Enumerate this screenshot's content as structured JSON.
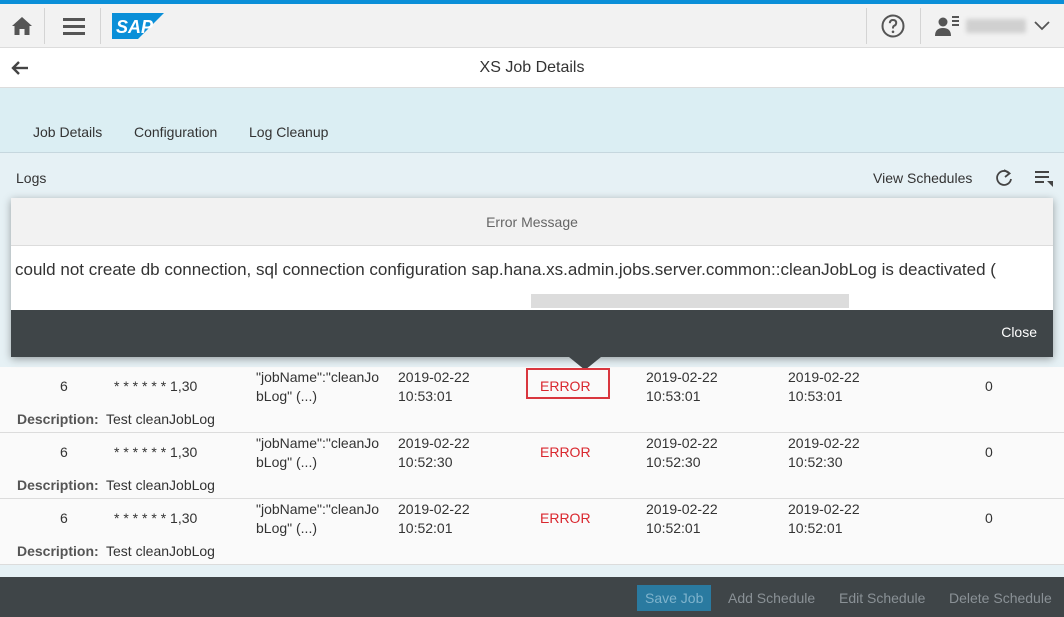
{
  "shell": {
    "logo_text": "SAP",
    "icons": {
      "home": "home-icon",
      "menu": "menu-icon",
      "help": "help-icon",
      "user": "user-icon",
      "chevron": "chevron-down-icon"
    }
  },
  "page": {
    "title": "XS Job Details"
  },
  "tabs": [
    {
      "label": "Job Details"
    },
    {
      "label": "Configuration"
    },
    {
      "label": "Log Cleanup"
    }
  ],
  "logs_toolbar": {
    "title": "Logs",
    "view_schedules": "View Schedules"
  },
  "error_popover": {
    "title": "Error Message",
    "message": "could not create db connection, sql connection configuration sap.hana.xs.admin.jobs.server.common::cleanJobLog is deactivated (",
    "close_label": "Close"
  },
  "log_rows": [
    {
      "num": "6",
      "schedule": "* * * * * * 1,30",
      "params_line1": "\"jobName\":\"cleanJo",
      "params_line2": "bLog\" (...)",
      "planned_date": "2019-02-22",
      "planned_time": "10:53:01",
      "status": "ERROR",
      "started_date": "2019-02-22",
      "started_time": "10:53:01",
      "finished_date": "2019-02-22",
      "finished_time": "10:53:01",
      "count": "0",
      "description_label": "Description:",
      "description": "Test cleanJobLog"
    },
    {
      "num": "6",
      "schedule": "* * * * * * 1,30",
      "params_line1": "\"jobName\":\"cleanJo",
      "params_line2": "bLog\" (...)",
      "planned_date": "2019-02-22",
      "planned_time": "10:52:30",
      "status": "ERROR",
      "started_date": "2019-02-22",
      "started_time": "10:52:30",
      "finished_date": "2019-02-22",
      "finished_time": "10:52:30",
      "count": "0",
      "description_label": "Description:",
      "description": "Test cleanJobLog"
    },
    {
      "num": "6",
      "schedule": "* * * * * * 1,30",
      "params_line1": "\"jobName\":\"cleanJo",
      "params_line2": "bLog\" (...)",
      "planned_date": "2019-02-22",
      "planned_time": "10:52:01",
      "status": "ERROR",
      "started_date": "2019-02-22",
      "started_time": "10:52:01",
      "finished_date": "2019-02-22",
      "finished_time": "10:52:01",
      "count": "0",
      "description_label": "Description:",
      "description": "Test cleanJobLog"
    }
  ],
  "footer": {
    "save_job": "Save Job",
    "add_schedule": "Add Schedule",
    "edit_schedule": "Edit Schedule",
    "delete_schedule": "Delete Schedule"
  },
  "colors": {
    "accent": "#0a8fd8",
    "header_bg": "#dbeef3",
    "footer_bg": "#3f4548",
    "error": "#d9272e"
  }
}
